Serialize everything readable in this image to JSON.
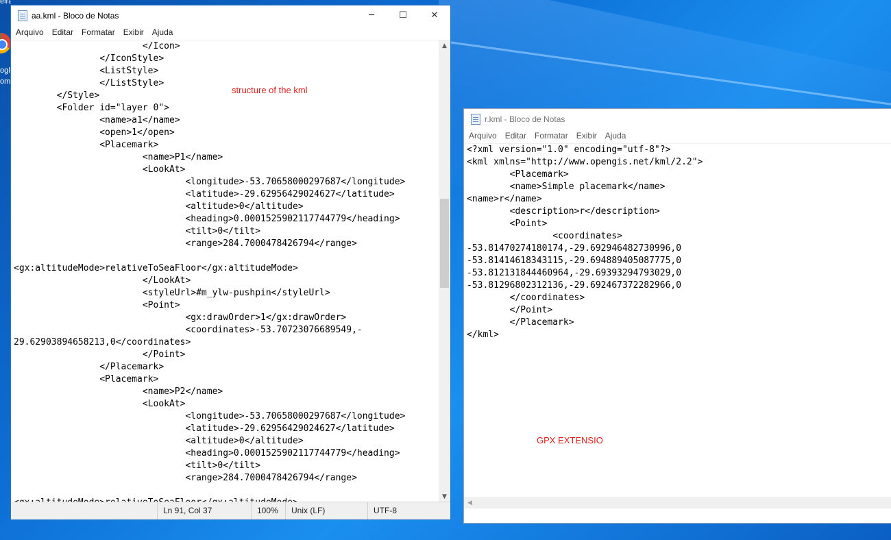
{
  "desktop": {
    "labels": [
      "eira",
      "ogl",
      "om"
    ]
  },
  "window1": {
    "title": "aa.kml - Bloco de Notas",
    "menu": [
      "Arquivo",
      "Editar",
      "Formatar",
      "Exibir",
      "Ajuda"
    ],
    "controls": {
      "minimize": "─",
      "maximize": "☐",
      "close": "✕"
    },
    "lines": [
      "                        </Icon>",
      "                </IconStyle>",
      "                <ListStyle>",
      "                </ListStyle>",
      "        </Style>",
      "        <Folder id=\"layer 0\">",
      "                <name>a1</name>",
      "                <open>1</open>",
      "                <Placemark>",
      "                        <name>P1</name>",
      "                        <LookAt>",
      "                                <longitude>-53.70658000297687</longitude>",
      "                                <latitude>-29.62956429024627</latitude>",
      "                                <altitude>0</altitude>",
      "                                <heading>0.0001525902117744779</heading>",
      "                                <tilt>0</tilt>",
      "                                <range>284.7000478426794</range>",
      "",
      "<gx:altitudeMode>relativeToSeaFloor</gx:altitudeMode>",
      "                        </LookAt>",
      "                        <styleUrl>#m_ylw-pushpin</styleUrl>",
      "                        <Point>",
      "                                <gx:drawOrder>1</gx:drawOrder>",
      "                                <coordinates>-53.70723076689549,-",
      "29.62903894658213,0</coordinates>",
      "                        </Point>",
      "                </Placemark>",
      "                <Placemark>",
      "                        <name>P2</name>",
      "                        <LookAt>",
      "                                <longitude>-53.70658000297687</longitude>",
      "                                <latitude>-29.62956429024627</latitude>",
      "                                <altitude>0</altitude>",
      "                                <heading>0.0001525902117744779</heading>",
      "                                <tilt>0</tilt>",
      "                                <range>284.7000478426794</range>",
      "",
      "<gx:altitudeMode>relativeToSeaFloor</gx:altitudeMode>"
    ],
    "status": {
      "position": "Ln 91, Col 37",
      "zoom": "100%",
      "line_ending": "Unix (LF)",
      "encoding": "UTF-8"
    },
    "scroll_up": "▲",
    "scroll_down": "▼"
  },
  "window2": {
    "title": "r.kml - Bloco de Notas",
    "menu": [
      "Arquivo",
      "Editar",
      "Formatar",
      "Exibir",
      "Ajuda"
    ],
    "lines": [
      "<?xml version=\"1.0\" encoding=\"utf-8\"?>",
      "<kml xmlns=\"http://www.opengis.net/kml/2.2\">",
      "        <Placemark>",
      "        <name>Simple placemark</name>",
      "<name>r</name>",
      "        <description>r</description>",
      "        <Point>",
      "                <coordinates>",
      "-53.81470274180174,-29.692946482730996,0",
      "-53.81414618343115,-29.694889405087775,0",
      "-53.812131844460964,-29.69393294793029,0",
      "-53.81296802312136,-29.692467372282966,0",
      "        </coordinates>",
      "        </Point>",
      "        </Placemark>",
      "</kml>"
    ],
    "scroll_left": "◀"
  },
  "annotations": {
    "kml_note": "structure of the kml",
    "gpx_note": "GPX EXTENSIO"
  },
  "colors": {
    "annotation": "#e0201b",
    "window_border_active": "#2b78c9"
  }
}
